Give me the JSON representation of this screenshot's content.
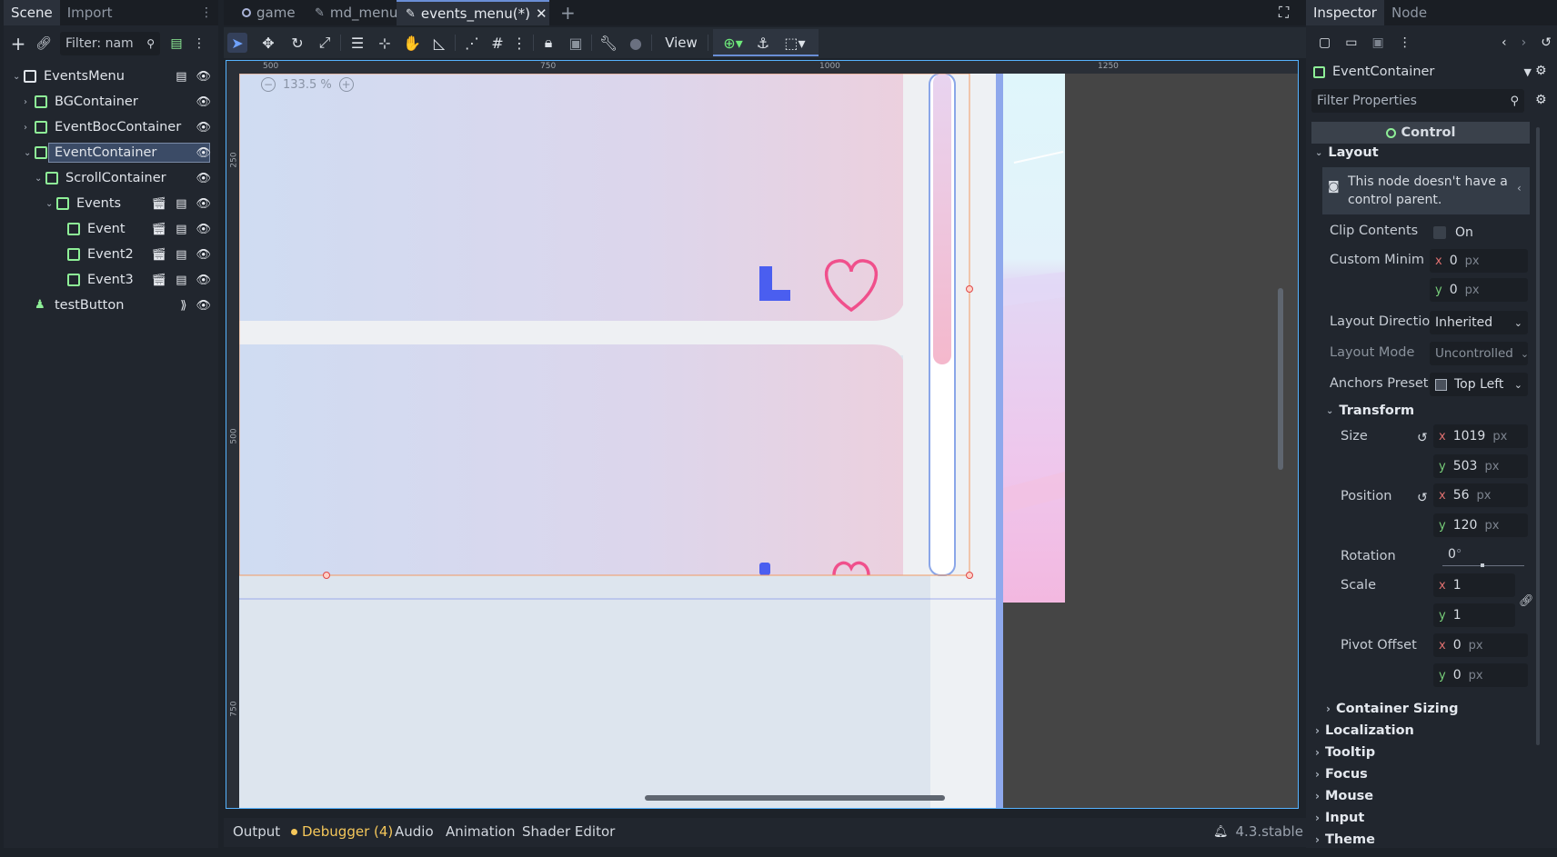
{
  "scene_dock": {
    "tabs": [
      "Scene",
      "Import"
    ],
    "filter_placeholder": "Filter: nam",
    "tree": [
      {
        "label": "EventsMenu",
        "level": 0
      },
      {
        "label": "BGContainer",
        "level": 1
      },
      {
        "label": "EventBocContainer",
        "level": 1
      },
      {
        "label": "EventContainer",
        "level": 1
      },
      {
        "label": "ScrollContainer",
        "level": 2
      },
      {
        "label": "Events",
        "level": 3
      },
      {
        "label": "Event",
        "level": 4
      },
      {
        "label": "Event2",
        "level": 4
      },
      {
        "label": "Event3",
        "level": 4
      },
      {
        "label": "testButton",
        "level": 1
      }
    ]
  },
  "center_tabs": [
    {
      "label": "game"
    },
    {
      "label": "md_menu"
    },
    {
      "label": "events_menu(*)"
    }
  ],
  "toolbar": {
    "view_label": "View"
  },
  "viewport": {
    "zoom_label": "133.5 %",
    "ruler_top": [
      "500",
      "750",
      "1000",
      "1250"
    ],
    "ruler_left": [
      "250",
      "500",
      "750"
    ]
  },
  "inspector": {
    "tabs": [
      "Inspector",
      "Node"
    ],
    "node_name": "EventContainer",
    "filter_placeholder": "Filter Properties",
    "class_header": "Control",
    "layout_section": "Layout",
    "warning": "This node doesn't have a control parent.",
    "props": {
      "clip_contents": {
        "label": "Clip Contents",
        "value": "On"
      },
      "custom_min": {
        "label": "Custom Minim",
        "x": "0",
        "y": "0",
        "unit": "px"
      },
      "layout_direction": {
        "label": "Layout Directio",
        "value": "Inherited"
      },
      "layout_mode": {
        "label": "Layout Mode",
        "value": "Uncontrolled"
      },
      "anchors_preset": {
        "label": "Anchors Preset",
        "value": "Top Left"
      },
      "transform_section": "Transform",
      "size": {
        "label": "Size",
        "x": "1019",
        "y": "503",
        "unit": "px"
      },
      "position": {
        "label": "Position",
        "x": "56",
        "y": "120",
        "unit": "px"
      },
      "rotation": {
        "label": "Rotation",
        "value": "0",
        "unit": "°"
      },
      "scale": {
        "label": "Scale",
        "x": "1",
        "y": "1"
      },
      "pivot_offset": {
        "label": "Pivot Offset",
        "x": "0",
        "y": "0",
        "unit": "px"
      }
    },
    "sections": [
      "Container Sizing",
      "Localization",
      "Tooltip",
      "Focus",
      "Mouse",
      "Input",
      "Theme"
    ]
  },
  "bottom_bar": {
    "tabs": [
      "Output",
      "Debugger (4)",
      "Audio",
      "Animation",
      "Shader Editor"
    ],
    "version": "4.3.stable"
  },
  "colors": {
    "accent": "#6a8ed6",
    "node_green": "#8eef97",
    "debugger_yellow": "#f5c75a",
    "heart_pink": "#f0508c",
    "arrow_blue": "#4a5ef0"
  }
}
